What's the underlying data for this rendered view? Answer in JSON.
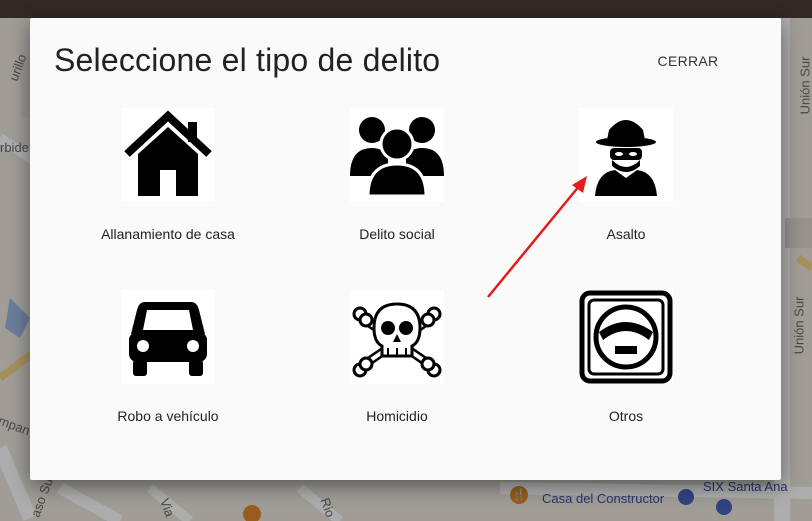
{
  "map": {
    "street_labels": [
      "urillo",
      "rbide",
      "Unión Sur",
      "Unión Sur",
      "mpan",
      "aso Sur",
      "Via",
      "Rio"
    ],
    "poi_labels": [
      "Casa del Constructor",
      "SIX Santa Ana"
    ]
  },
  "dialog": {
    "title": "Seleccione el tipo de delito",
    "close_label": "CERRAR",
    "options": [
      {
        "label": "Allanamiento de casa",
        "icon": "house-icon"
      },
      {
        "label": "Delito social",
        "icon": "group-icon"
      },
      {
        "label": "Asalto",
        "icon": "burglar-icon"
      },
      {
        "label": "Robo a vehículo",
        "icon": "car-icon"
      },
      {
        "label": "Homicidio",
        "icon": "skull-crossbones-icon"
      },
      {
        "label": "Otros",
        "icon": "face-icon"
      }
    ]
  },
  "colors": {
    "topbar": "#4a3c35",
    "dialog_bg": "#fafafa",
    "arrow": "#e41b1b",
    "poi_label": "#3b4fa3"
  }
}
